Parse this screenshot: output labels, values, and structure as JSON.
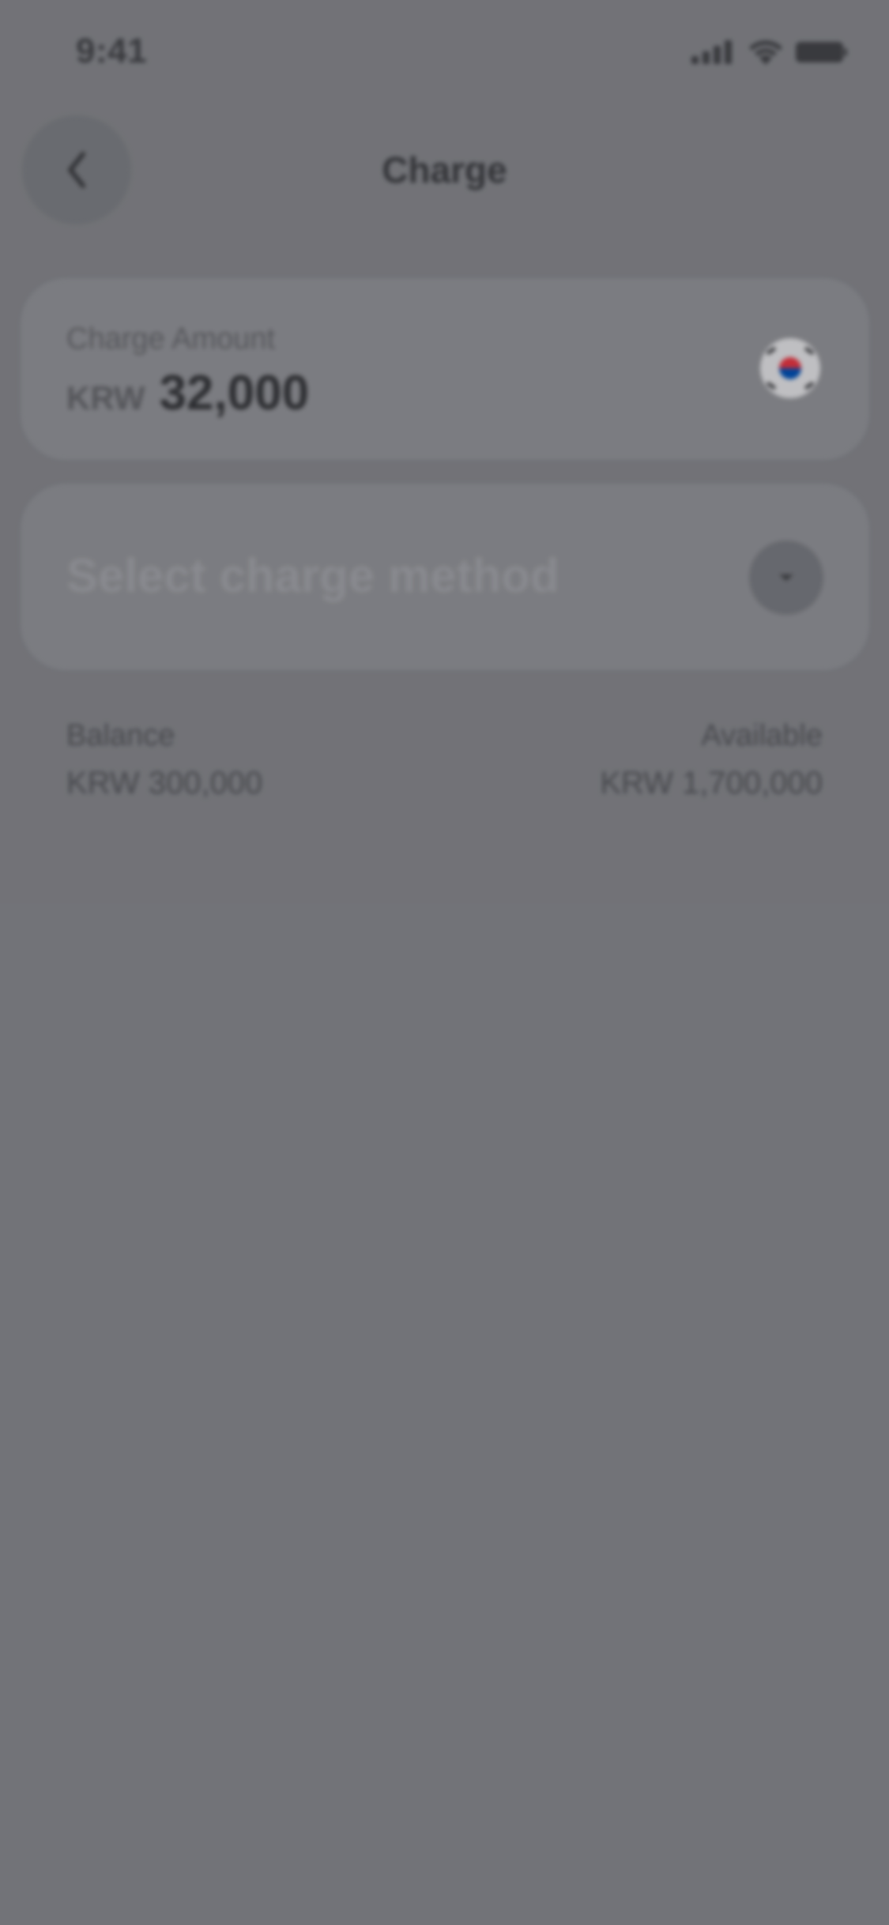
{
  "status_bar": {
    "time": "9:41",
    "icons": [
      "signal-icon",
      "wifi-icon",
      "battery-icon"
    ]
  },
  "header": {
    "title": "Charge",
    "back_icon": "chevron-left-icon"
  },
  "amount_card": {
    "label": "Charge Amount",
    "currency": "KRW",
    "value": "32,000",
    "flag_icon": "south-korea-flag-icon"
  },
  "method_card": {
    "placeholder": "Select charge method",
    "dropdown_icon": "chevron-down-icon"
  },
  "balance": {
    "label": "Balance",
    "value": "KRW 300,000"
  },
  "available": {
    "label": "Available",
    "value": "KRW 1,700,000"
  },
  "colors": {
    "background": "#77787d",
    "card": "#818287",
    "flag_red": "#cd2e3a",
    "flag_blue": "#0047a0"
  }
}
